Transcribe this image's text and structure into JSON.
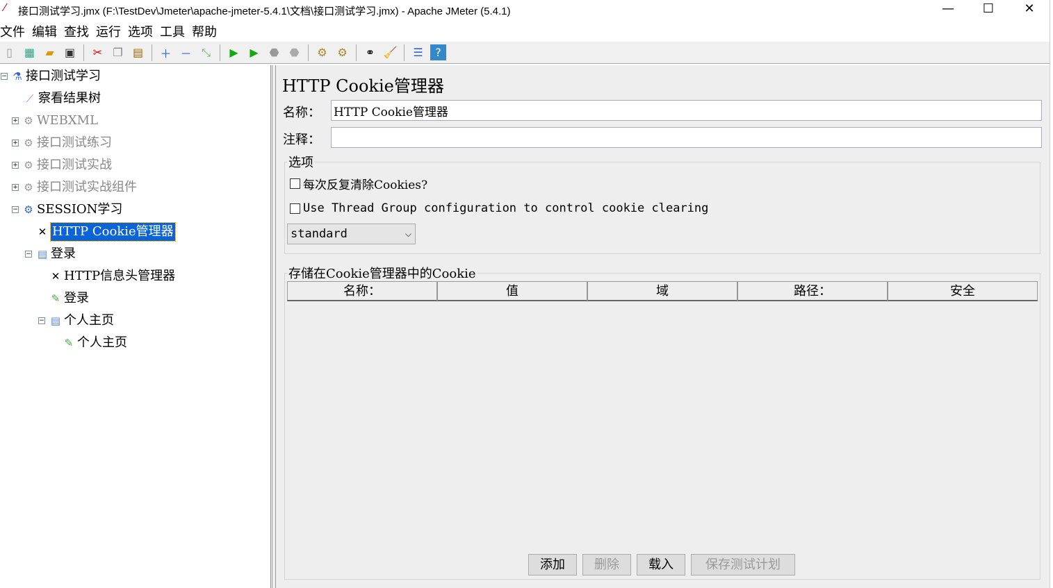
{
  "window": {
    "title": "接口测试学习.jmx (F:\\TestDev\\Jmeter\\apache-jmeter-5.4.1\\文档\\接口测试学习.jmx) - Apache JMeter (5.4.1)",
    "minimize": "—",
    "maximize": "☐",
    "close": "✕"
  },
  "menu": [
    "文件",
    "编辑",
    "查找",
    "运行",
    "选项",
    "工具",
    "帮助"
  ],
  "toolbar": [
    "new-icon",
    "templates-icon",
    "open-icon",
    "save-icon",
    "cut-icon",
    "copy-icon",
    "paste-icon",
    "expand-icon",
    "collapse-icon",
    "toggle-icon",
    "start-icon",
    "start-no-pauses-icon",
    "stop-icon",
    "shutdown-icon",
    "clear-icon",
    "clear-all-icon",
    "search-icon",
    "reset-search-icon",
    "function-helper-icon",
    "help-icon"
  ],
  "tree": [
    {
      "label": "接口测试学习",
      "icon": "test-plan-icon"
    },
    {
      "label": "察看结果树",
      "icon": "listener-icon"
    },
    {
      "label": "WEBXML",
      "icon": "thread-group-icon",
      "disabled": true
    },
    {
      "label": "接口测试练习",
      "icon": "thread-group-icon",
      "disabled": true
    },
    {
      "label": "接口测试实战",
      "icon": "thread-group-icon",
      "disabled": true
    },
    {
      "label": "接口测试实战组件",
      "icon": "thread-group-icon",
      "disabled": true
    },
    {
      "label": "SESSION学习",
      "icon": "thread-group-icon"
    },
    {
      "label": "HTTP Cookie管理器",
      "icon": "config-icon",
      "selected": true
    },
    {
      "label": "登录",
      "icon": "controller-icon"
    },
    {
      "label": "HTTP信息头管理器",
      "icon": "config-icon"
    },
    {
      "label": "登录",
      "icon": "sampler-icon"
    },
    {
      "label": "个人主页",
      "icon": "controller-icon"
    },
    {
      "label": "个人主页",
      "icon": "sampler-icon"
    }
  ],
  "panel": {
    "title": "HTTP Cookie管理器",
    "name_label": "名称：",
    "name_value": "HTTP Cookie管理器",
    "comment_label": "注释：",
    "comment_value": "",
    "options_legend": "选项",
    "clear_each_iteration": "每次反复清除Cookies?",
    "use_thread_group": "Use Thread Group configuration to control cookie clearing",
    "policy": "standard",
    "cookies_legend": "存储在Cookie管理器中的Cookie",
    "columns": [
      "名称：",
      "值",
      "域",
      "路径：",
      "安全"
    ],
    "buttons": {
      "add": "添加",
      "delete": "删除",
      "load": "载入",
      "save": "保存测试计划"
    }
  }
}
